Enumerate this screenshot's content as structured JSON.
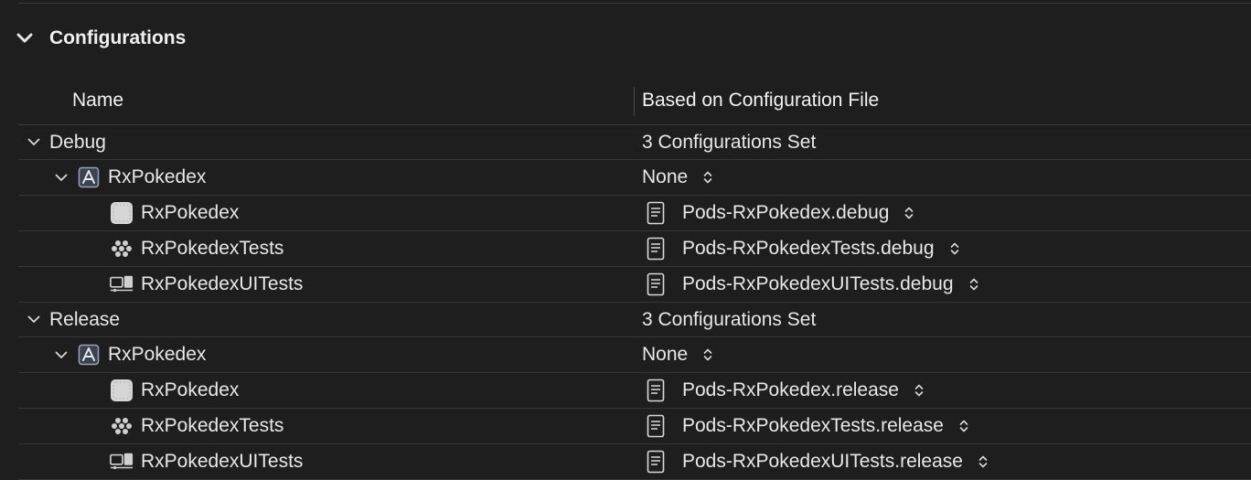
{
  "section": {
    "title": "Configurations",
    "expanded": true
  },
  "columns": {
    "name": "Name",
    "file": "Based on Configuration File"
  },
  "configurations": [
    {
      "name": "Debug",
      "summary": "3 Configurations Set",
      "project": {
        "name": "RxPokedex",
        "value": "None",
        "icon": "project-icon"
      },
      "targets": [
        {
          "name": "RxPokedex",
          "icon": "app-target-icon",
          "file": "Pods-RxPokedex.debug"
        },
        {
          "name": "RxPokedexTests",
          "icon": "unit-test-target-icon",
          "file": "Pods-RxPokedexTests.debug"
        },
        {
          "name": "RxPokedexUITests",
          "icon": "ui-test-target-icon",
          "file": "Pods-RxPokedexUITests.debug"
        }
      ]
    },
    {
      "name": "Release",
      "summary": "3 Configurations Set",
      "project": {
        "name": "RxPokedex",
        "value": "None",
        "icon": "project-icon"
      },
      "targets": [
        {
          "name": "RxPokedex",
          "icon": "app-target-icon",
          "file": "Pods-RxPokedex.release"
        },
        {
          "name": "RxPokedexTests",
          "icon": "unit-test-target-icon",
          "file": "Pods-RxPokedexTests.release"
        },
        {
          "name": "RxPokedexUITests",
          "icon": "ui-test-target-icon",
          "file": "Pods-RxPokedexUITests.release"
        }
      ]
    }
  ],
  "colors": {
    "background": "#1e1e1e",
    "text": "#e6e6e6",
    "separator": "#363636"
  }
}
